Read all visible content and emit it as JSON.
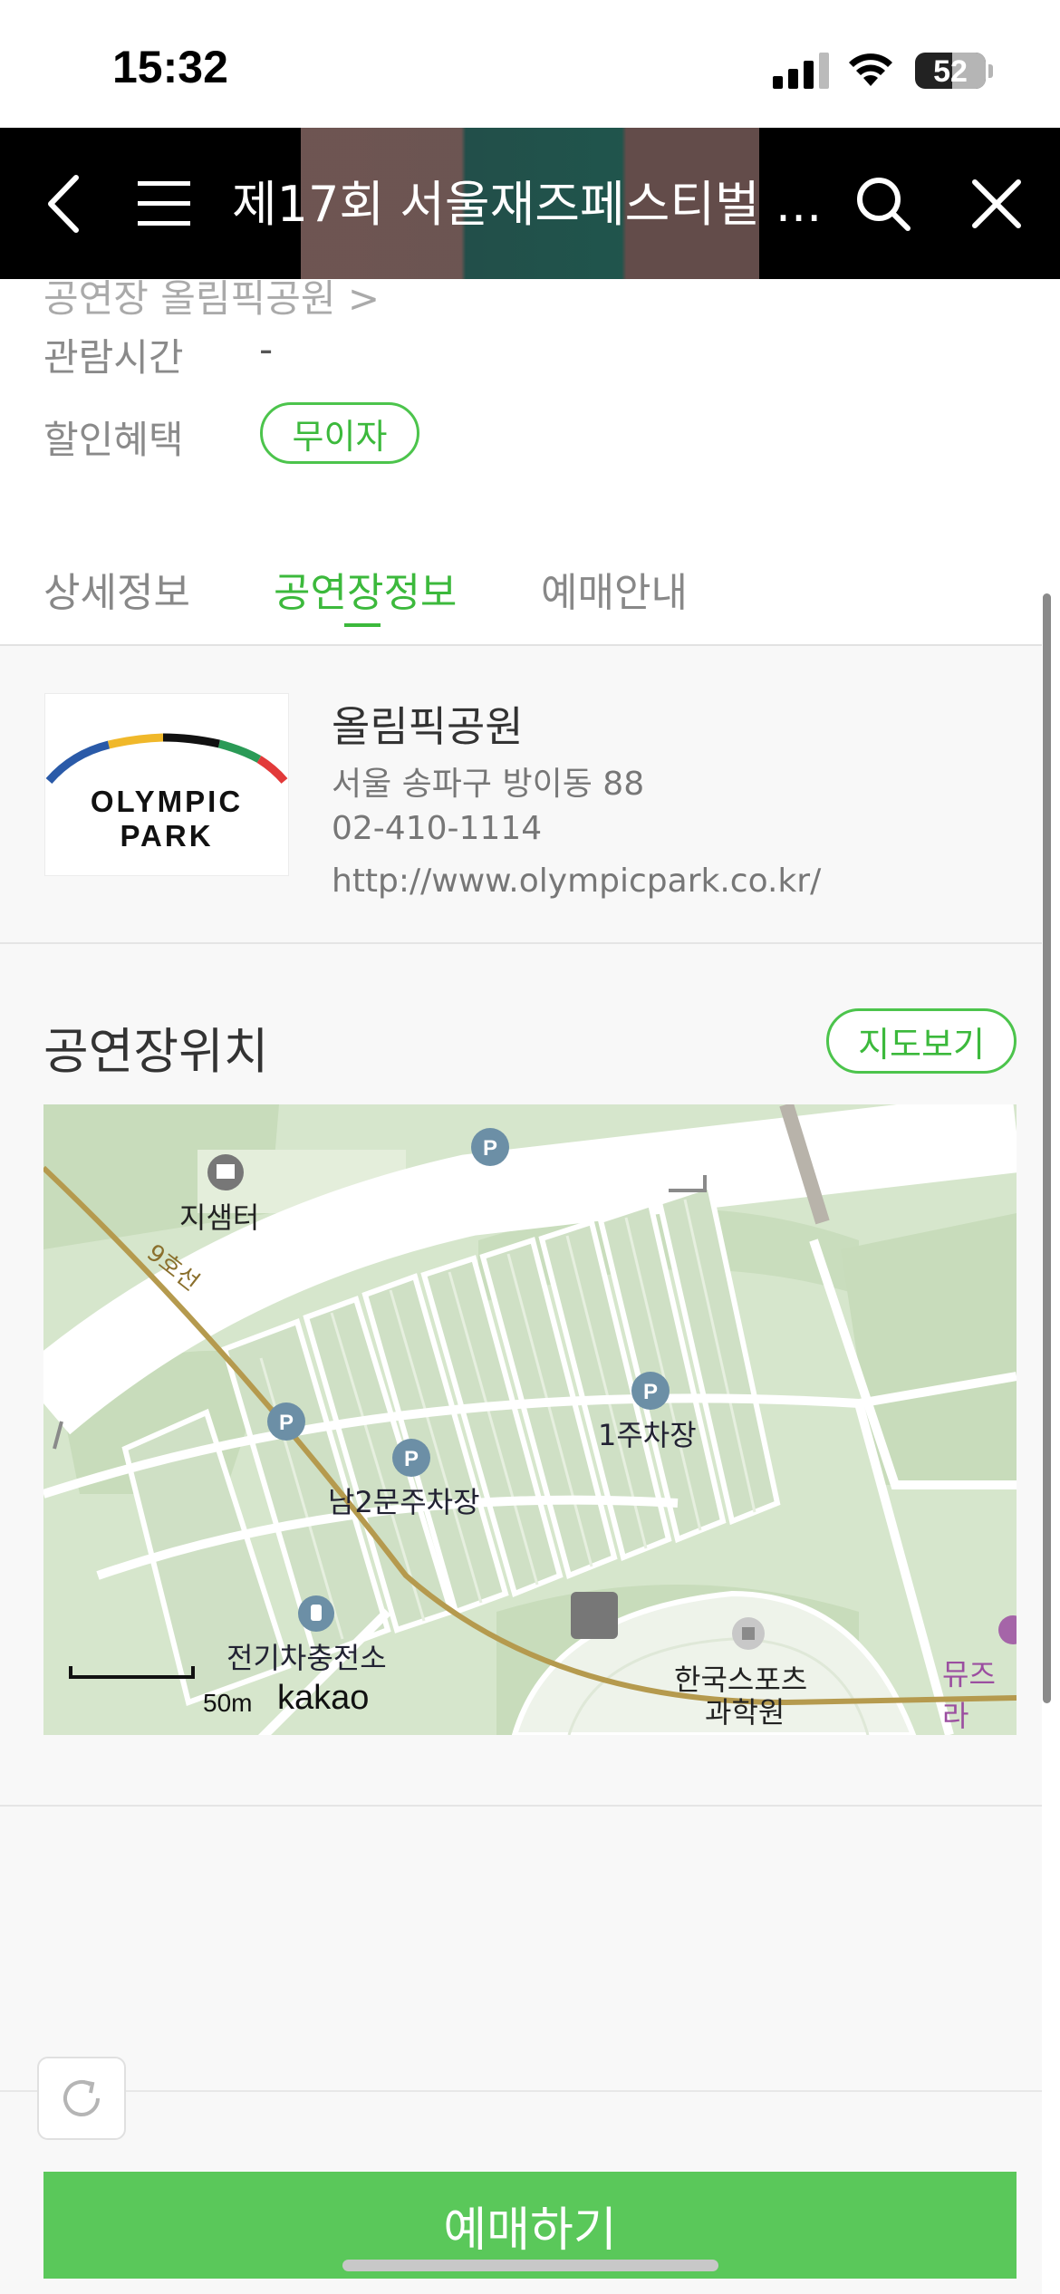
{
  "status_bar": {
    "time": "15:32",
    "battery_level": "52"
  },
  "nav": {
    "title": "제17회 서울재즈페스티벌 ..."
  },
  "info": {
    "partial_row": "공연장  올림픽공원 >",
    "rows": [
      {
        "label": "관람시간",
        "value": "-"
      },
      {
        "label": "할인혜택",
        "badge": "무이자"
      }
    ]
  },
  "tabs": [
    {
      "label": "상세정보",
      "active": false
    },
    {
      "label": "공연장정보",
      "active": true
    },
    {
      "label": "예매안내",
      "active": false
    }
  ],
  "venue": {
    "logo_text": "OLYMPIC PARK",
    "name": "올림픽공원",
    "address": "서울 송파구 방이동 88",
    "phone": "02-410-1114",
    "url": "http://www.olympicpark.co.kr/"
  },
  "location": {
    "title": "공연장위치",
    "map_button": "지도보기",
    "map": {
      "labels": {
        "library": "지샘터",
        "line9": "9호선",
        "parking1": "1주차장",
        "parking_south2": "남2문주차장",
        "ev_charging": "전기차충전소",
        "sports_science": "한국스포츠",
        "sports_science_2": "과학원",
        "museum": "뮤즈라"
      },
      "scale": "50m",
      "provider": "kakao"
    }
  },
  "booking": {
    "button_label": "예매하기"
  },
  "colors": {
    "accent": "#5ac85a",
    "accent_text": "#3cb93c",
    "nav_bg": "#000000"
  }
}
